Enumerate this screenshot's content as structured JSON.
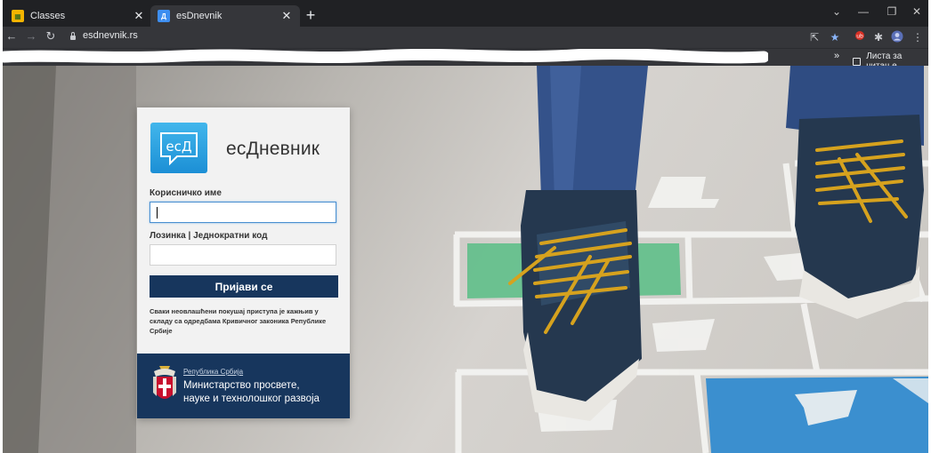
{
  "browser": {
    "tabs": [
      {
        "title": "Classes",
        "favicon": "classes-favicon-icon",
        "active": false
      },
      {
        "title": "esDnevnik",
        "favicon": "esdnevnik-favicon-icon",
        "active": true
      }
    ],
    "new_tab": "+",
    "url": "esdnevnik.rs",
    "bookmarks_more": "»",
    "reading_list": "Листа за читање"
  },
  "login": {
    "brand": "есДневник",
    "logo_text": "есД",
    "username_label": "Корисничко име",
    "username_value": "",
    "password_label": "Лозинка | Једнократни код",
    "password_value": "",
    "submit_label": "Пријави се",
    "notice": "Сваки неовлашћени покушај приступа је кажњив у складу са одредбама Кривичног законика Републике Србије",
    "footer": {
      "republic": "Република Србија",
      "ministry_line1": "Министарство просвете,",
      "ministry_line2": "науке и технолошког развоја"
    }
  },
  "colors": {
    "brand_navy": "#17365d",
    "logo_blue": "#2ba3e3",
    "chrome_dark": "#202124"
  }
}
